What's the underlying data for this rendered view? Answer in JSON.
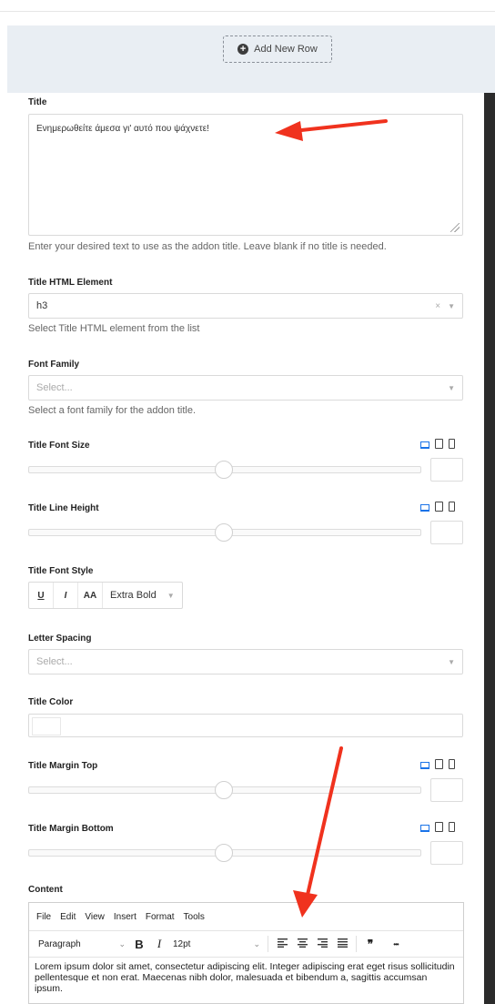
{
  "builder": {
    "add_row_label": "Add New Row"
  },
  "title_field": {
    "label": "Title",
    "value": "Ενημερωθείτε άμεσα γι' αυτό που ψάχνετε!",
    "help": "Enter your desired text to use as the addon title. Leave blank if no title is needed."
  },
  "title_html_element": {
    "label": "Title HTML Element",
    "value": "h3",
    "clear_glyph": "×",
    "help": "Select Title HTML element from the list"
  },
  "font_family": {
    "label": "Font Family",
    "placeholder": "Select...",
    "help": "Select a font family for the addon title."
  },
  "title_font_size": {
    "label": "Title Font Size",
    "slider_fraction": 0.5
  },
  "title_line_height": {
    "label": "Title Line Height",
    "slider_fraction": 0.5
  },
  "title_font_style": {
    "label": "Title Font Style",
    "underline": "U",
    "italic": "I",
    "uppercase": "AA",
    "weight": "Extra Bold"
  },
  "letter_spacing": {
    "label": "Letter Spacing",
    "placeholder": "Select..."
  },
  "title_color": {
    "label": "Title Color",
    "value": "#ffffff"
  },
  "title_margin_top": {
    "label": "Title Margin Top",
    "slider_fraction": 0.5
  },
  "title_margin_bottom": {
    "label": "Title Margin Bottom",
    "slider_fraction": 0.5
  },
  "content": {
    "label": "Content",
    "menu": [
      "File",
      "Edit",
      "View",
      "Insert",
      "Format",
      "Tools"
    ],
    "block_format": "Paragraph",
    "bold": "B",
    "italic": "I",
    "font_size": "12pt",
    "quote": "❞",
    "more": "•••",
    "text": "Lorem ipsum dolor sit amet, consectetur adipiscing elit. Integer adipiscing erat eget risus sollicitudin pellentesque et non erat. Maecenas nibh dolor, malesuada et bibendum a, sagittis accumsan ipsum."
  },
  "colors": {
    "accent": "#1a73e8",
    "annotation_arrow": "#f0321e",
    "builder_bg": "#e9eef3"
  }
}
